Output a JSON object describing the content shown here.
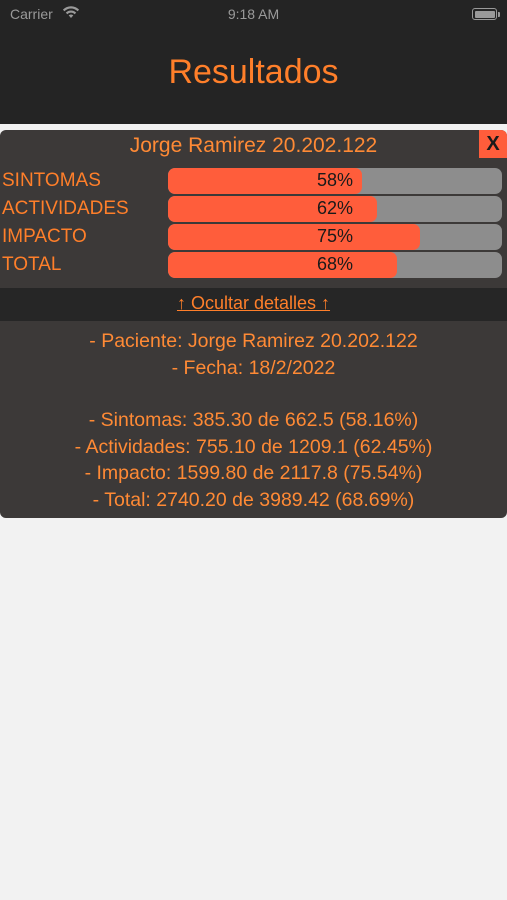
{
  "status_bar": {
    "carrier": "Carrier",
    "time": "9:18 AM"
  },
  "header": {
    "title": "Resultados"
  },
  "card": {
    "patient": "Jorge Ramirez 20.202.122",
    "close_label": "X",
    "bars": [
      {
        "label": "SINTOMAS",
        "percent_text": "58%",
        "value": 0.5816
      },
      {
        "label": "ACTIVIDADES",
        "percent_text": "62%",
        "value": 0.6245
      },
      {
        "label": "IMPACTO",
        "percent_text": "75%",
        "value": 0.7554
      },
      {
        "label": "TOTAL",
        "percent_text": "68%",
        "value": 0.6869
      }
    ],
    "toggle_label": "↑ Ocultar detalles ↑",
    "details": {
      "paciente": "- Paciente: Jorge Ramirez 20.202.122",
      "fecha": "- Fecha: 18/2/2022",
      "sintomas": "- Sintomas: 385.30 de 662.5 (58.16%)",
      "actividades": "- Actividades: 755.10 de 1209.1 (62.45%)",
      "impacto": "- Impacto: 1599.80 de 2117.8 (75.54%)",
      "total": "- Total: 2740.20 de 3989.42 (68.69%)"
    }
  },
  "colors": {
    "accent": "#ff7f2a",
    "bar_fill": "#ff5d3b",
    "bar_track": "#8d8d8d",
    "card_bg": "#3c3938",
    "header_bg": "#242424",
    "page_bg": "#f2f2f2"
  }
}
